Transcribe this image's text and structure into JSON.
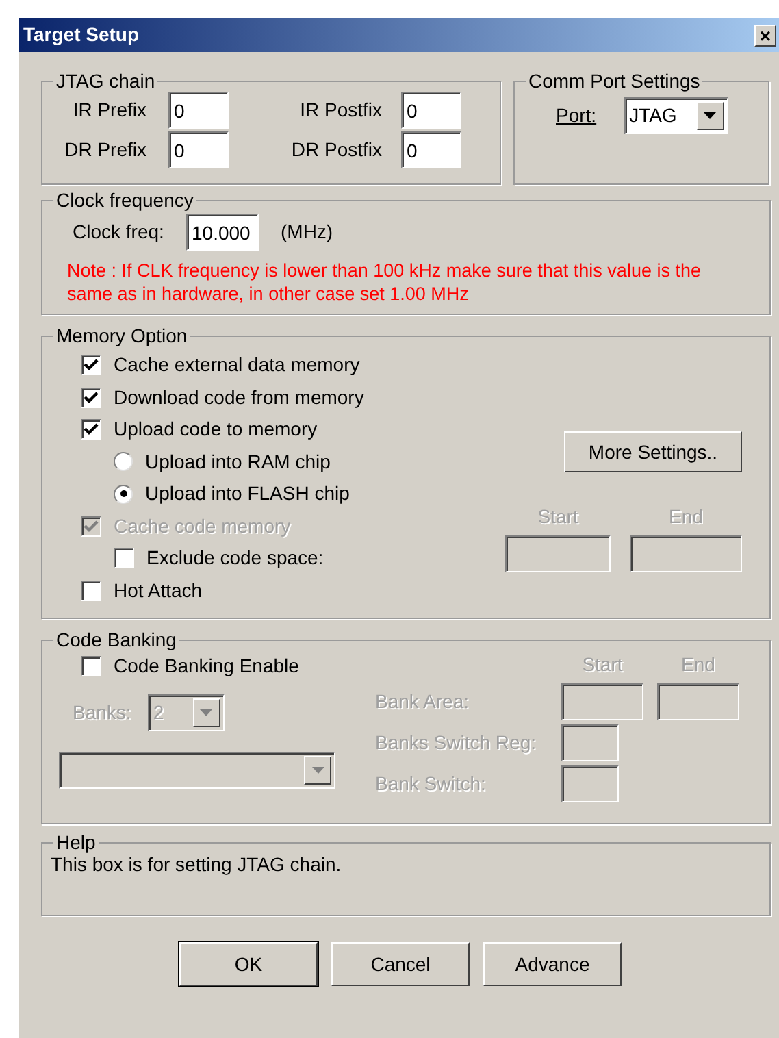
{
  "window": {
    "title": "Target Setup",
    "close": "×"
  },
  "jtag_chain": {
    "title": "JTAG chain",
    "fields": [
      {
        "label": "IR Prefix",
        "value": "0"
      },
      {
        "label": "IR Postfix",
        "value": "0"
      },
      {
        "label": "DR Prefix",
        "value": "0"
      },
      {
        "label": "DR Postfix",
        "value": "0"
      }
    ]
  },
  "comm_port": {
    "title": "Comm Port Settings",
    "label": "Port:",
    "value": "JTAG"
  },
  "clock": {
    "title": "Clock frequency",
    "label": "Clock freq:",
    "value": "10.000",
    "unit": "(MHz)",
    "note": "Note : If CLK frequency is lower than 100 kHz make sure that this value is the same as in hardware, in other case set 1.00 MHz"
  },
  "memory_option": {
    "title": "Memory Option",
    "options": [
      {
        "kind": "checkbox",
        "label": "Cache external data memory",
        "checked": true,
        "disabled": false
      },
      {
        "kind": "checkbox",
        "label": "Download code from memory",
        "checked": true,
        "disabled": false
      },
      {
        "kind": "checkbox",
        "label": "Upload code to memory",
        "checked": true,
        "disabled": false,
        "children": [
          {
            "kind": "radio",
            "label": "Upload into RAM chip",
            "selected": false,
            "disabled": false
          },
          {
            "kind": "radio",
            "label": "Upload into FLASH chip",
            "selected": true,
            "disabled": false
          }
        ]
      },
      {
        "kind": "checkbox",
        "label": "Cache code memory",
        "checked": true,
        "disabled": true,
        "children": [
          {
            "kind": "checkbox",
            "label": "Exclude code space:",
            "checked": false,
            "disabled": false
          }
        ]
      },
      {
        "kind": "checkbox",
        "label": "Hot Attach",
        "checked": false,
        "disabled": false
      }
    ],
    "more_settings": "More Settings..",
    "start_label": "Start",
    "end_label": "End",
    "range_disabled": true
  },
  "code_banking": {
    "title": "Code Banking",
    "enable": {
      "kind": "checkbox",
      "label": "Code Banking Enable",
      "checked": false,
      "disabled": false
    },
    "disabled": true,
    "banks": {
      "label": "Banks:",
      "value": "2"
    },
    "start_label": "Start",
    "end_label": "End",
    "bank_area": "Bank Area:",
    "switch_reg": "Banks Switch Reg:",
    "bank_switch": "Bank Switch:"
  },
  "help": {
    "title": "Help",
    "text": "This box is for setting JTAG chain."
  },
  "buttons": [
    {
      "label": "OK",
      "default": true
    },
    {
      "label": "Cancel",
      "default": false
    },
    {
      "label": "Advance",
      "default": false
    }
  ]
}
